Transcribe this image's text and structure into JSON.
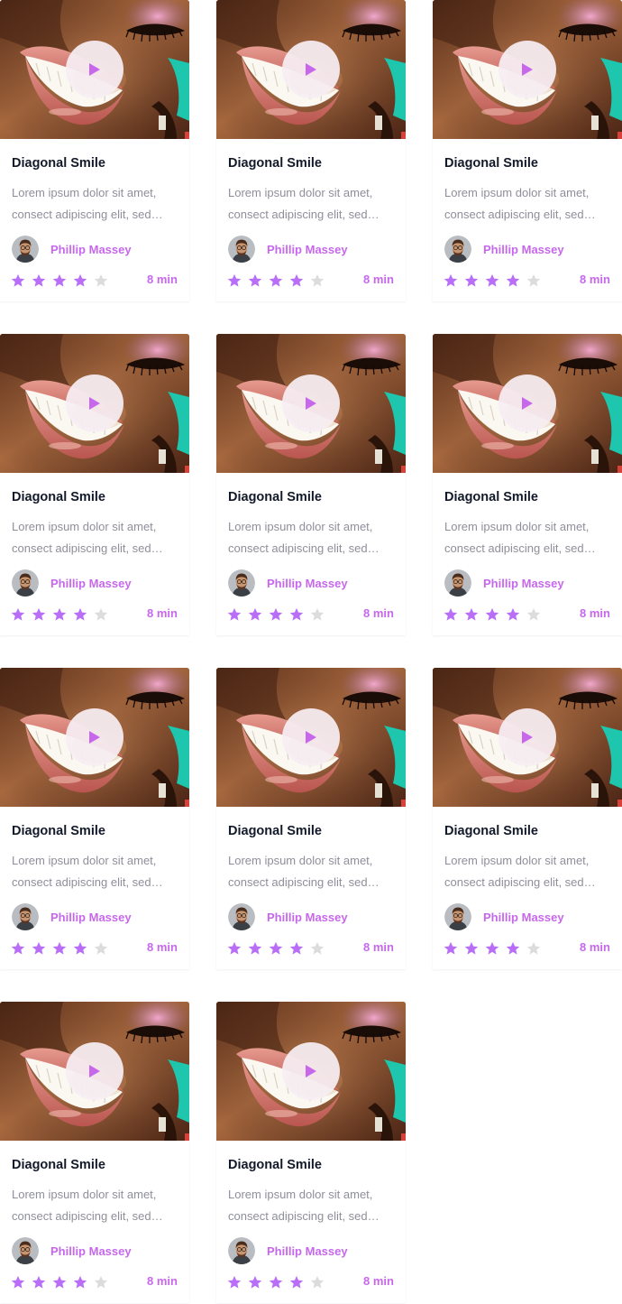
{
  "colors": {
    "accent": "#c768ec",
    "star_filled": "#b96ef7",
    "star_empty": "#dcdcdc",
    "title": "#121a2a",
    "description": "#8f8f9b"
  },
  "cards": [
    {
      "title": "Diagonal Smile",
      "description": [
        "Lorem ipsum dolor sit amet,",
        "consect adipiscing elit, sed…"
      ],
      "author": "Phillip Massey",
      "rating": 4,
      "max_rating": 5,
      "duration": "8 min",
      "thumbnail_icon": "play-icon"
    },
    {
      "title": "Diagonal Smile",
      "description": [
        "Lorem ipsum dolor sit amet,",
        "consect adipiscing elit, sed…"
      ],
      "author": "Phillip Massey",
      "rating": 4,
      "max_rating": 5,
      "duration": "8 min",
      "thumbnail_icon": "play-icon"
    },
    {
      "title": "Diagonal Smile",
      "description": [
        "Lorem ipsum dolor sit amet,",
        "consect adipiscing elit, sed…"
      ],
      "author": "Phillip Massey",
      "rating": 4,
      "max_rating": 5,
      "duration": "8 min",
      "thumbnail_icon": "play-icon"
    },
    {
      "title": "Diagonal Smile",
      "description": [
        "Lorem ipsum dolor sit amet,",
        "consect adipiscing elit, sed…"
      ],
      "author": "Phillip Massey",
      "rating": 4,
      "max_rating": 5,
      "duration": "8 min",
      "thumbnail_icon": "play-icon"
    },
    {
      "title": "Diagonal Smile",
      "description": [
        "Lorem ipsum dolor sit amet,",
        "consect adipiscing elit, sed…"
      ],
      "author": "Phillip Massey",
      "rating": 4,
      "max_rating": 5,
      "duration": "8 min",
      "thumbnail_icon": "play-icon"
    },
    {
      "title": "Diagonal Smile",
      "description": [
        "Lorem ipsum dolor sit amet,",
        "consect adipiscing elit, sed…"
      ],
      "author": "Phillip Massey",
      "rating": 4,
      "max_rating": 5,
      "duration": "8 min",
      "thumbnail_icon": "play-icon"
    },
    {
      "title": "Diagonal Smile",
      "description": [
        "Lorem ipsum dolor sit amet,",
        "consect adipiscing elit, sed…"
      ],
      "author": "Phillip Massey",
      "rating": 4,
      "max_rating": 5,
      "duration": "8 min",
      "thumbnail_icon": "play-icon"
    },
    {
      "title": "Diagonal Smile",
      "description": [
        "Lorem ipsum dolor sit amet,",
        "consect adipiscing elit, sed…"
      ],
      "author": "Phillip Massey",
      "rating": 4,
      "max_rating": 5,
      "duration": "8 min",
      "thumbnail_icon": "play-icon"
    },
    {
      "title": "Diagonal Smile",
      "description": [
        "Lorem ipsum dolor sit amet,",
        "consect adipiscing elit, sed…"
      ],
      "author": "Phillip Massey",
      "rating": 4,
      "max_rating": 5,
      "duration": "8 min",
      "thumbnail_icon": "play-icon"
    },
    {
      "title": "Diagonal Smile",
      "description": [
        "Lorem ipsum dolor sit amet,",
        "consect adipiscing elit, sed…"
      ],
      "author": "Phillip Massey",
      "rating": 4,
      "max_rating": 5,
      "duration": "8 min",
      "thumbnail_icon": "play-icon"
    },
    {
      "title": "Diagonal Smile",
      "description": [
        "Lorem ipsum dolor sit amet,",
        "consect adipiscing elit, sed…"
      ],
      "author": "Phillip Massey",
      "rating": 4,
      "max_rating": 5,
      "duration": "8 min",
      "thumbnail_icon": "play-icon"
    }
  ]
}
